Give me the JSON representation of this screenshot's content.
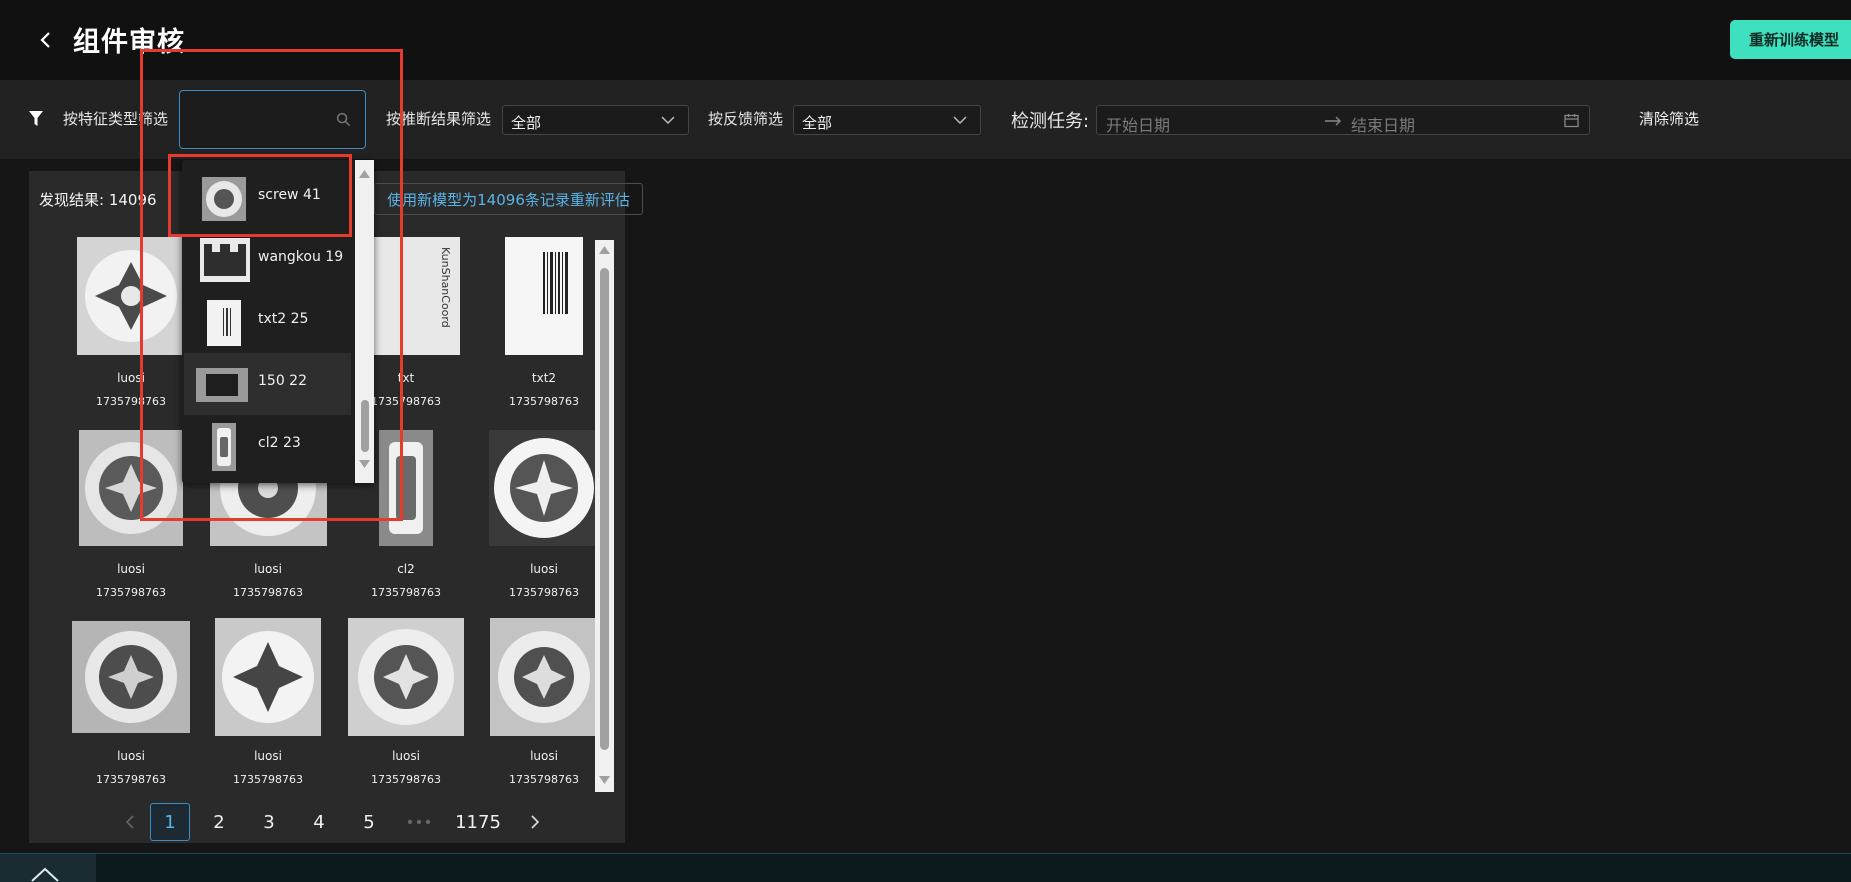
{
  "header": {
    "title": "组件审核",
    "retrain_label": "重新训练模型"
  },
  "filters": {
    "feature_type_label": "按特征类型筛选",
    "feature_type_value": "",
    "inference_label": "按推断结果筛选",
    "inference_value": "全部",
    "feedback_label": "按反馈筛选",
    "feedback_value": "全部",
    "task_label": "检测任务:",
    "start_placeholder": "开始日期",
    "end_placeholder": "结束日期",
    "clear_label": "清除筛选"
  },
  "results": {
    "found_label": "发现结果: 14096",
    "reeval_label": "使用新模型为14096条记录重新评估",
    "items": [
      {
        "name": "luosi",
        "ts": "1735798763"
      },
      {
        "name": "",
        "ts": ""
      },
      {
        "name": "txt",
        "ts": "1735798763"
      },
      {
        "name": "txt2",
        "ts": "1735798763"
      },
      {
        "name": "luosi",
        "ts": "1735798763"
      },
      {
        "name": "luosi",
        "ts": "1735798763"
      },
      {
        "name": "cl2",
        "ts": "1735798763"
      },
      {
        "name": "luosi",
        "ts": "1735798763"
      },
      {
        "name": "luosi",
        "ts": "1735798763"
      },
      {
        "name": "luosi",
        "ts": "1735798763"
      },
      {
        "name": "luosi",
        "ts": "1735798763"
      },
      {
        "name": "luosi",
        "ts": "1735798763"
      }
    ]
  },
  "dropdown": {
    "options": [
      {
        "label": "screw 41",
        "icon": "screw-thumbnail"
      },
      {
        "label": "wangkou 19",
        "icon": "connector-thumbnail"
      },
      {
        "label": "txt2 25",
        "icon": "label-thumbnail"
      },
      {
        "label": "150 22",
        "icon": "chip-thumbnail"
      },
      {
        "label": "cl2 23",
        "icon": "component-thumbnail"
      }
    ]
  },
  "pagination": {
    "pages": [
      "1",
      "2",
      "3",
      "4",
      "5",
      "1175"
    ],
    "current": "1"
  },
  "colors": {
    "accent": "#3fe0bf",
    "link": "#5ab4e6",
    "highlight": "#e63a2e"
  }
}
